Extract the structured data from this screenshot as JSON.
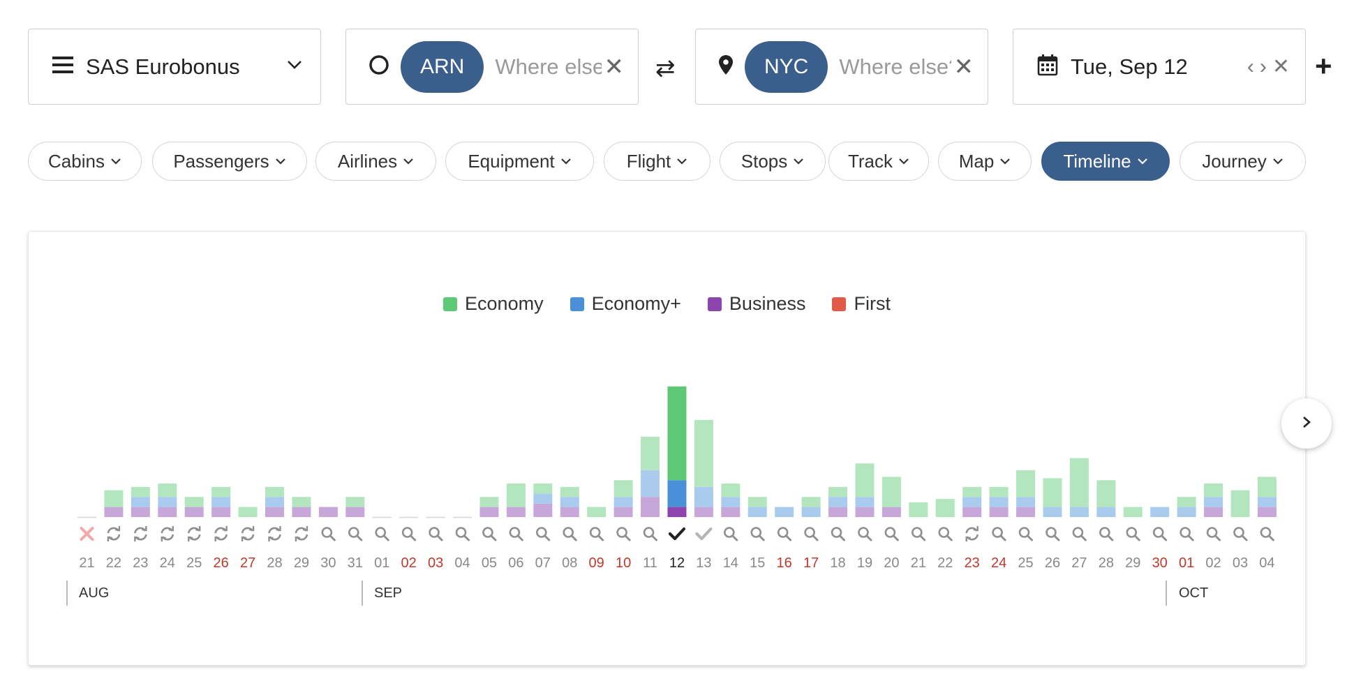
{
  "search": {
    "program": "SAS Eurobonus",
    "origin_code": "ARN",
    "origin_placeholder": "Where else?",
    "destination_code": "NYC",
    "destination_placeholder": "Where else?",
    "date": "Tue, Sep 12"
  },
  "filters": [
    "Cabins",
    "Passengers",
    "Airlines",
    "Equipment",
    "Flight",
    "Stops",
    "Track",
    "Map",
    "Timeline",
    "Journey"
  ],
  "active_filter": "Timeline",
  "colors": {
    "accent": "#3a5f8d",
    "economy": "#5dc977",
    "economy_plus": "#4a90d9",
    "business": "#8e44ad",
    "first": "#e05a47",
    "weekend_label": "#c0392b"
  },
  "chart_data": {
    "type": "bar",
    "stacked": true,
    "legend": [
      "Economy",
      "Economy+",
      "Business",
      "First"
    ],
    "legend_position": "top",
    "months": [
      "AUG",
      "SEP",
      "OCT"
    ],
    "selected_day": "12",
    "days": [
      {
        "day": "21",
        "month": "AUG",
        "weekend": false,
        "status": "error",
        "business": 0,
        "economy_plus": 0,
        "economy": 0
      },
      {
        "day": "22",
        "month": "AUG",
        "weekend": false,
        "status": "refresh",
        "business": 1.5,
        "economy_plus": 0,
        "economy": 2.5
      },
      {
        "day": "23",
        "month": "AUG",
        "weekend": false,
        "status": "refresh",
        "business": 1.5,
        "economy_plus": 1.5,
        "economy": 1.5
      },
      {
        "day": "24",
        "month": "AUG",
        "weekend": false,
        "status": "refresh",
        "business": 1.5,
        "economy_plus": 1.5,
        "economy": 2
      },
      {
        "day": "25",
        "month": "AUG",
        "weekend": false,
        "status": "refresh",
        "business": 1.5,
        "economy_plus": 0,
        "economy": 1.5
      },
      {
        "day": "26",
        "month": "AUG",
        "weekend": true,
        "status": "refresh",
        "business": 1.5,
        "economy_plus": 1.5,
        "economy": 1.5
      },
      {
        "day": "27",
        "month": "AUG",
        "weekend": true,
        "status": "refresh",
        "business": 0,
        "economy_plus": 0,
        "economy": 1.5
      },
      {
        "day": "28",
        "month": "AUG",
        "weekend": false,
        "status": "refresh",
        "business": 1.5,
        "economy_plus": 1.5,
        "economy": 1.5
      },
      {
        "day": "29",
        "month": "AUG",
        "weekend": false,
        "status": "refresh",
        "business": 1.5,
        "economy_plus": 0,
        "economy": 1.5
      },
      {
        "day": "30",
        "month": "AUG",
        "weekend": false,
        "status": "search",
        "business": 1.5,
        "economy_plus": 0,
        "economy": 0
      },
      {
        "day": "31",
        "month": "AUG",
        "weekend": false,
        "status": "search",
        "business": 1.5,
        "economy_plus": 0,
        "economy": 1.5
      },
      {
        "day": "01",
        "month": "SEP",
        "weekend": false,
        "status": "search",
        "business": 0,
        "economy_plus": 0,
        "economy": 0
      },
      {
        "day": "02",
        "month": "SEP",
        "weekend": true,
        "status": "search",
        "business": 0,
        "economy_plus": 0,
        "economy": 0
      },
      {
        "day": "03",
        "month": "SEP",
        "weekend": true,
        "status": "search",
        "business": 0,
        "economy_plus": 0,
        "economy": 0
      },
      {
        "day": "04",
        "month": "SEP",
        "weekend": false,
        "status": "search",
        "business": 0,
        "economy_plus": 0,
        "economy": 0
      },
      {
        "day": "05",
        "month": "SEP",
        "weekend": false,
        "status": "search",
        "business": 1.5,
        "economy_plus": 0,
        "economy": 1.5
      },
      {
        "day": "06",
        "month": "SEP",
        "weekend": false,
        "status": "search",
        "business": 1.5,
        "economy_plus": 0,
        "economy": 3.5
      },
      {
        "day": "07",
        "month": "SEP",
        "weekend": false,
        "status": "search",
        "business": 2,
        "economy_plus": 1.5,
        "economy": 1.5
      },
      {
        "day": "08",
        "month": "SEP",
        "weekend": false,
        "status": "search",
        "business": 1.5,
        "economy_plus": 1.5,
        "economy": 1.5
      },
      {
        "day": "09",
        "month": "SEP",
        "weekend": true,
        "status": "search",
        "business": 0,
        "economy_plus": 0,
        "economy": 1.5
      },
      {
        "day": "10",
        "month": "SEP",
        "weekend": true,
        "status": "search",
        "business": 1.5,
        "economy_plus": 1.5,
        "economy": 2.5
      },
      {
        "day": "11",
        "month": "SEP",
        "weekend": false,
        "status": "search",
        "business": 3,
        "economy_plus": 4,
        "economy": 5
      },
      {
        "day": "12",
        "month": "SEP",
        "weekend": false,
        "status": "selected",
        "business": 1.5,
        "economy_plus": 4,
        "economy": 14
      },
      {
        "day": "13",
        "month": "SEP",
        "weekend": false,
        "status": "done",
        "business": 1.5,
        "economy_plus": 3,
        "economy": 10
      },
      {
        "day": "14",
        "month": "SEP",
        "weekend": false,
        "status": "search",
        "business": 1.5,
        "economy_plus": 1.5,
        "economy": 2
      },
      {
        "day": "15",
        "month": "SEP",
        "weekend": false,
        "status": "search",
        "business": 0,
        "economy_plus": 1.5,
        "economy": 1.5
      },
      {
        "day": "16",
        "month": "SEP",
        "weekend": true,
        "status": "search",
        "business": 0,
        "economy_plus": 1.5,
        "economy": 0
      },
      {
        "day": "17",
        "month": "SEP",
        "weekend": true,
        "status": "search",
        "business": 0,
        "economy_plus": 1.5,
        "economy": 1.5
      },
      {
        "day": "18",
        "month": "SEP",
        "weekend": false,
        "status": "search",
        "business": 1.5,
        "economy_plus": 1.5,
        "economy": 1.5
      },
      {
        "day": "19",
        "month": "SEP",
        "weekend": false,
        "status": "search",
        "business": 1.5,
        "economy_plus": 1.5,
        "economy": 5
      },
      {
        "day": "20",
        "month": "SEP",
        "weekend": false,
        "status": "search",
        "business": 1.5,
        "economy_plus": 0,
        "economy": 4.5
      },
      {
        "day": "21",
        "month": "SEP",
        "weekend": false,
        "status": "search",
        "business": 0,
        "economy_plus": 0,
        "economy": 2.2
      },
      {
        "day": "22",
        "month": "SEP",
        "weekend": false,
        "status": "search",
        "business": 0,
        "economy_plus": 0,
        "economy": 2.7
      },
      {
        "day": "23",
        "month": "SEP",
        "weekend": true,
        "status": "refresh",
        "business": 1.5,
        "economy_plus": 1.5,
        "economy": 1.5
      },
      {
        "day": "24",
        "month": "SEP",
        "weekend": true,
        "status": "search",
        "business": 1.5,
        "economy_plus": 1.5,
        "economy": 1.5
      },
      {
        "day": "25",
        "month": "SEP",
        "weekend": false,
        "status": "search",
        "business": 1.5,
        "economy_plus": 1.5,
        "economy": 4
      },
      {
        "day": "26",
        "month": "SEP",
        "weekend": false,
        "status": "search",
        "business": 0,
        "economy_plus": 1.5,
        "economy": 4.3
      },
      {
        "day": "27",
        "month": "SEP",
        "weekend": false,
        "status": "search",
        "business": 0,
        "economy_plus": 1.5,
        "economy": 7.3
      },
      {
        "day": "28",
        "month": "SEP",
        "weekend": false,
        "status": "search",
        "business": 0,
        "economy_plus": 1.5,
        "economy": 4
      },
      {
        "day": "29",
        "month": "SEP",
        "weekend": false,
        "status": "search",
        "business": 0,
        "economy_plus": 0,
        "economy": 1.5
      },
      {
        "day": "30",
        "month": "SEP",
        "weekend": true,
        "status": "search",
        "business": 0,
        "economy_plus": 1.5,
        "economy": 0
      },
      {
        "day": "01",
        "month": "OCT",
        "weekend": true,
        "status": "search",
        "business": 0,
        "economy_plus": 1.5,
        "economy": 1.5
      },
      {
        "day": "02",
        "month": "OCT",
        "weekend": false,
        "status": "search",
        "business": 1.5,
        "economy_plus": 1.5,
        "economy": 2
      },
      {
        "day": "03",
        "month": "OCT",
        "weekend": false,
        "status": "search",
        "business": 0,
        "economy_plus": 0,
        "economy": 4
      },
      {
        "day": "04",
        "month": "OCT",
        "weekend": false,
        "status": "search",
        "business": 1.5,
        "economy_plus": 1.5,
        "economy": 3
      }
    ]
  }
}
